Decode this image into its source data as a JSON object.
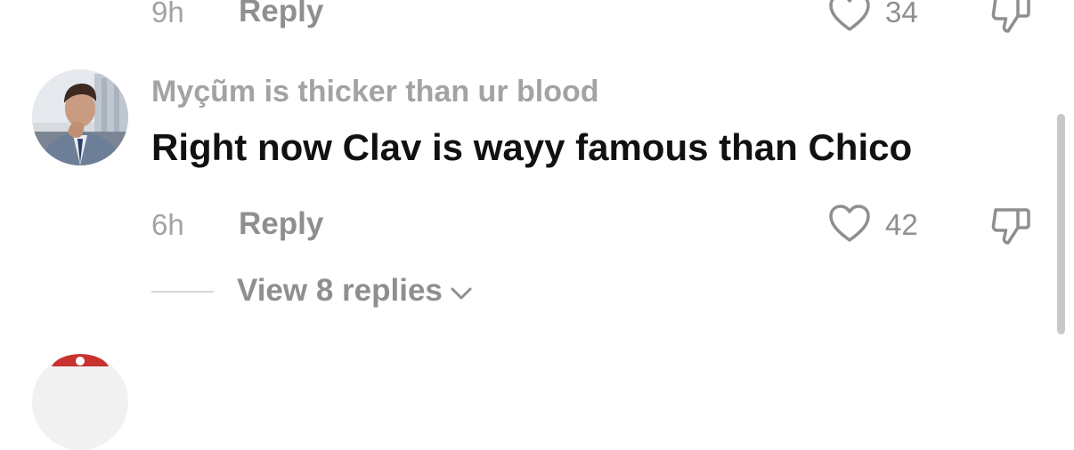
{
  "previous_comment": {
    "time": "9h",
    "reply_label": "Reply",
    "like_count": "34"
  },
  "comment": {
    "username": "Myçũm is thicker than ur blood",
    "text": "Right now Clav is wayy famous than Chico",
    "time": "6h",
    "reply_label": "Reply",
    "like_count": "42",
    "view_replies_label": "View 8 replies"
  },
  "icons": {
    "like": "heart-outline-icon",
    "dislike": "thumbs-down-icon",
    "expand": "chevron-down-icon"
  },
  "colors": {
    "meta_gray": "#8f8f8f",
    "username_gray": "#a3a3a3",
    "text": "#111111",
    "scrollbar": "#c8c8c8"
  }
}
